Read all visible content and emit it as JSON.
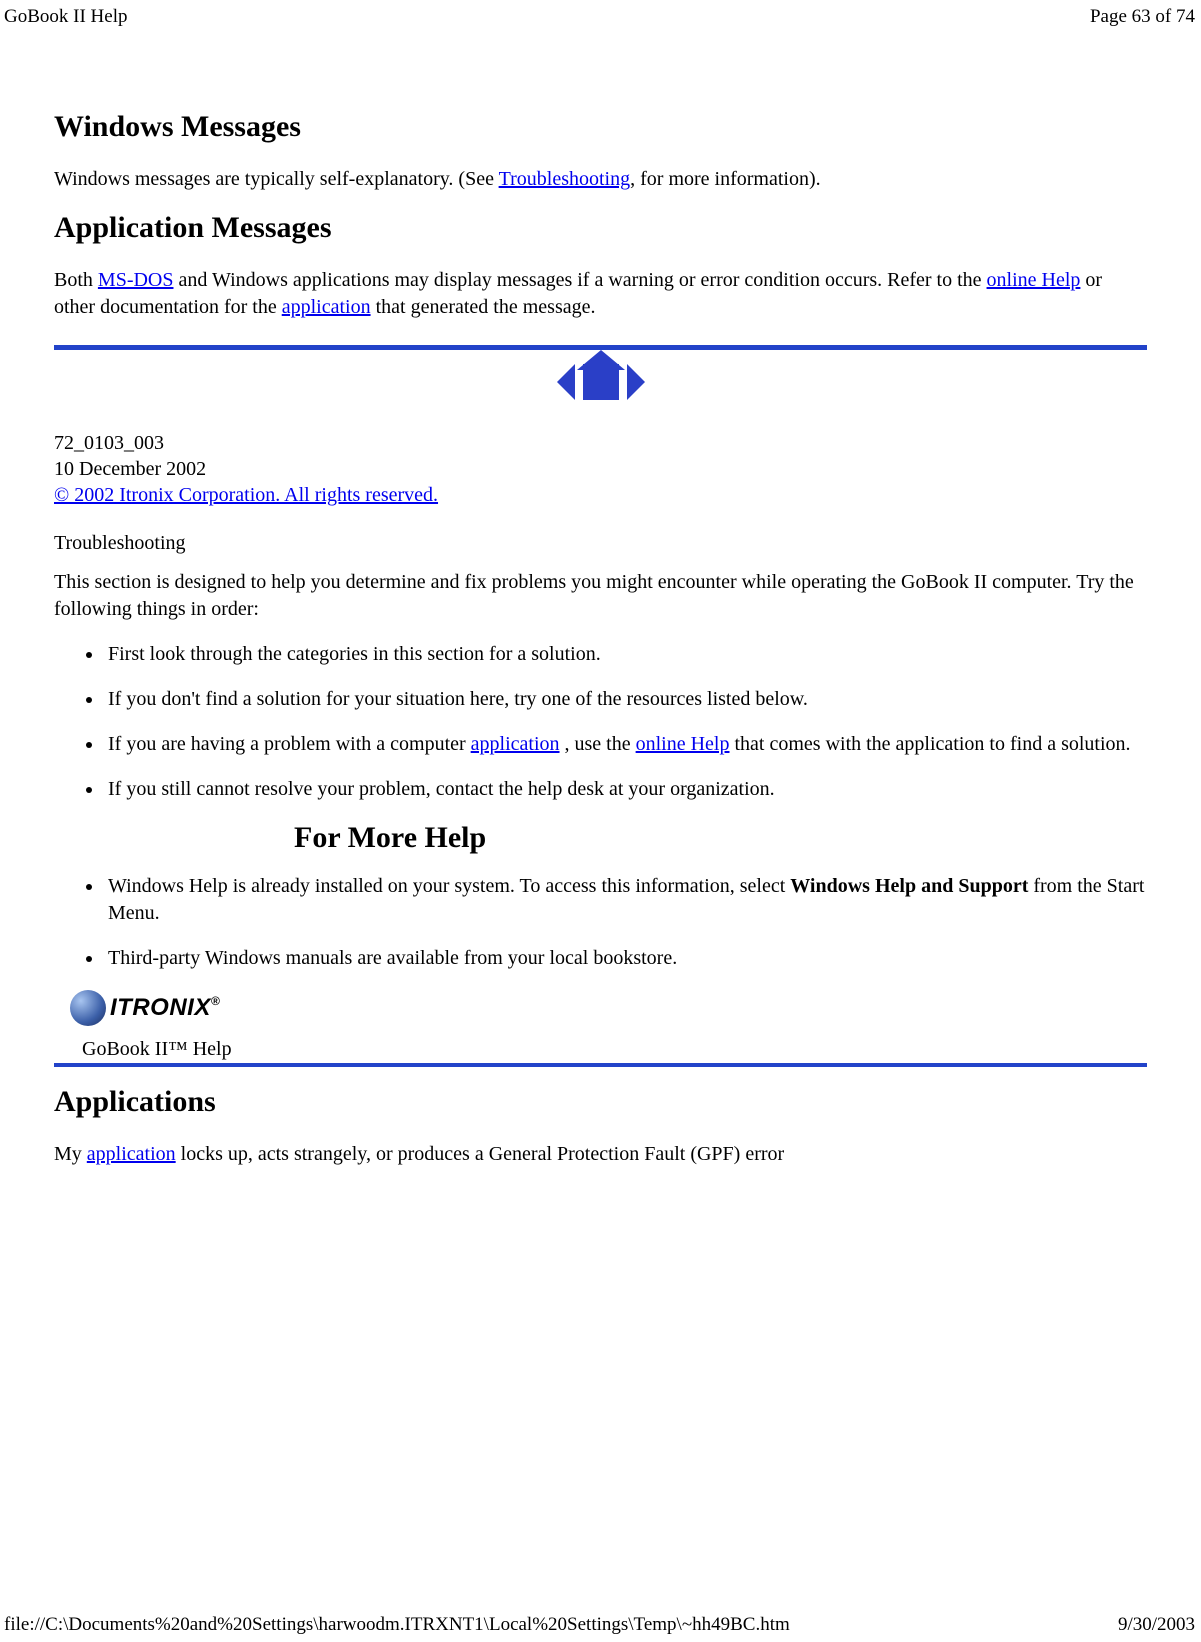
{
  "header": {
    "title": "GoBook II Help",
    "page": "Page 63 of 74"
  },
  "footer": {
    "path": "file://C:\\Documents%20and%20Settings\\harwoodm.ITRXNT1\\Local%20Settings\\Temp\\~hh49BC.htm",
    "date": "9/30/2003"
  },
  "sections": {
    "winmsg": {
      "title": "Windows Messages",
      "p1a": "Windows messages are typically self-explanatory. (See ",
      "link1": "Troubleshooting",
      "p1b": ", for more information)."
    },
    "appmsg": {
      "title": "Application Messages",
      "p1a": "Both ",
      "link1": "MS-DOS",
      "p1b": " and Windows applications may display messages if a warning or error condition occurs. Refer to the ",
      "link2": "online Help",
      "p1c": " or other documentation for the ",
      "link3": "application",
      "p1d": " that generated the message."
    },
    "docinfo": {
      "docnum": "72_0103_003",
      "date": "10 December 2002",
      "copyright": "© 2002 Itronix Corporation.  All rights reserved."
    },
    "troubleshooting": {
      "title": "Troubleshooting",
      "intro": "This section is designed to help you determine and fix problems you might encounter while operating the GoBook II computer. Try the following things in order:",
      "b1": "First look through the categories in this section for a solution.",
      "b2": "If you don't find a solution for your situation here, try one of the resources listed below.",
      "b3a": "If you are having a problem with a computer ",
      "b3link1": "application",
      "b3b": " , use the ",
      "b3link2": "online Help",
      "b3c": " that comes with the application to find a solution.",
      "b4": "If you still cannot resolve your problem, contact the help desk at your organization."
    },
    "moreHelp": {
      "title": "For More Help",
      "b1": "Windows Help is already installed on your system.  To access this information, select ",
      "b1bold": "Windows Help and Support",
      "b1b": " from the Start Menu.",
      "b2": "Third-party Windows manuals are available from your local bookstore."
    },
    "logo": {
      "text": "ITRONIX",
      "tm": "®"
    },
    "tab": {
      "label": "GoBook II™ Help"
    },
    "applications": {
      "title": "Applications",
      "p1a": "My ",
      "link1": "application",
      "p1b": " locks up, acts strangely, or produces a General Protection Fault (GPF) error"
    }
  }
}
